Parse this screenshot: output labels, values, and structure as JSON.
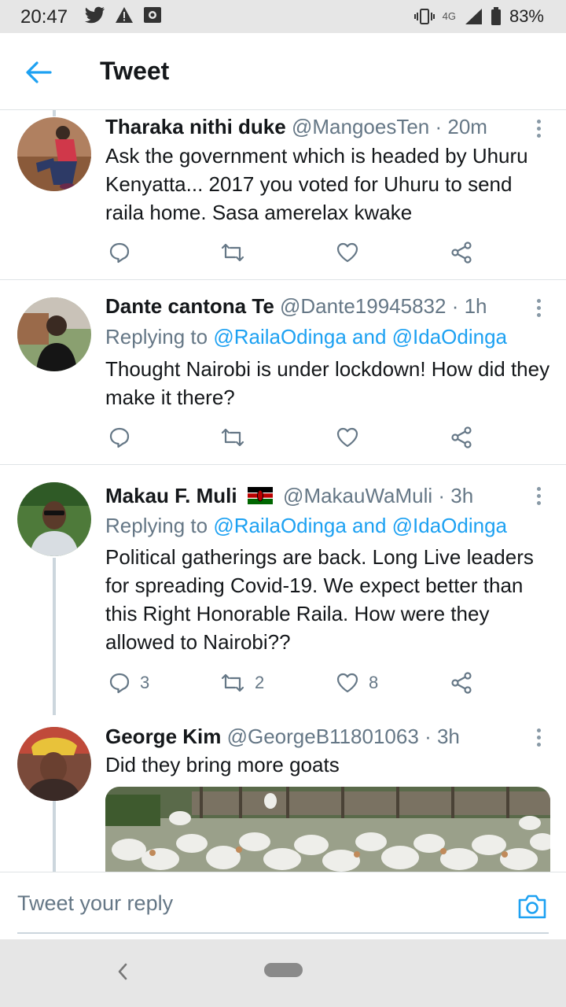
{
  "status_bar": {
    "time": "20:47",
    "network": "4G",
    "battery": "83%",
    "left_icons": [
      "twitter-bird-icon",
      "alert-icon",
      "image-icon"
    ]
  },
  "header": {
    "back_icon": "arrow-left-icon",
    "title": "Tweet"
  },
  "tweets": [
    {
      "name": "Tharaka nithi duke",
      "handle": "@MangoesTen",
      "time": "· 20m",
      "replying_prefix": "",
      "replying_to": "",
      "text": "Ask the government which is headed by Uhuru Kenyatta... 2017 you voted for Uhuru to send raila home. Sasa amerelax kwake",
      "reply_count": "",
      "retweet_count": "",
      "like_count": ""
    },
    {
      "name": "Dante cantona Te",
      "handle": "@Dante19945832",
      "time": "· 1h",
      "replying_prefix": "Replying to",
      "replying_to": "@RailaOdinga and @IdaOdinga",
      "text": "Thought Nairobi is under lockdown! How did they make it there?",
      "reply_count": "",
      "retweet_count": "",
      "like_count": ""
    },
    {
      "name": "Makau F. Muli",
      "handle": "@MakauWaMuli",
      "time": "· 3h",
      "flag_icon": "kenya-flag-icon",
      "replying_prefix": "Replying to",
      "replying_to": "@RailaOdinga and @IdaOdinga",
      "text": "Political gatherings are back. Long Live leaders for spreading Covid-19. We expect better than this Right Honorable Raila. How were they allowed to Nairobi??",
      "reply_count": "3",
      "retweet_count": "2",
      "like_count": "8"
    },
    {
      "name": "George Kim",
      "handle": "@GeorgeB11801063",
      "time": "· 3h",
      "text": "Did they bring more goats",
      "media": "goats-photo"
    }
  ],
  "action_icons": [
    "reply-icon",
    "retweet-icon",
    "like-icon",
    "share-icon"
  ],
  "reply_bar": {
    "placeholder": "Tweet your reply",
    "camera_icon": "camera-icon"
  },
  "nav_bar": {
    "back_icon": "nav-back-icon",
    "home_icon": "nav-home-pill"
  },
  "colors": {
    "accent": "#1da1f2",
    "text": "#14171a",
    "secondary_text": "#657786",
    "divider": "#dfe3e6"
  }
}
